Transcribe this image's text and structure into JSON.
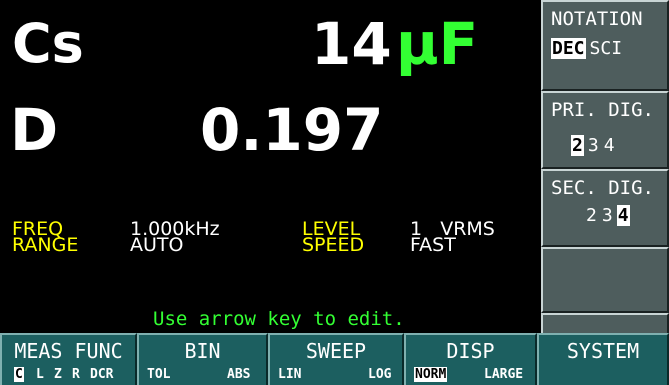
{
  "primary": {
    "label": "Cs",
    "value": "14",
    "unit": "µF"
  },
  "secondary": {
    "label": "D",
    "value": "0.197"
  },
  "params": {
    "freq_label": "FREQ",
    "freq_value": "1.000kHz",
    "range_label": "RANGE",
    "range_value": "AUTO",
    "level_label": "LEVEL",
    "level_value": "1   VRMS",
    "speed_label": "SPEED",
    "speed_value": "FAST"
  },
  "hint": "Use arrow key to edit.",
  "side_keys": {
    "notation": {
      "title": "NOTATION",
      "options": [
        "DEC",
        "SCI"
      ],
      "selected": "DEC"
    },
    "pri_dig": {
      "title": "PRI. DIG.",
      "options": [
        "2",
        "3",
        "4"
      ],
      "selected": "2"
    },
    "sec_dig": {
      "title": "SEC. DIG.",
      "options": [
        "2",
        "3",
        "4"
      ],
      "selected": "4"
    }
  },
  "function_keys": {
    "meas_func": {
      "label": "MEAS FUNC",
      "options": [
        "C",
        "L",
        "Z",
        "R",
        "DCR"
      ],
      "selected": "C"
    },
    "bin": {
      "label": "BIN",
      "options": [
        "TOL",
        "ABS"
      ]
    },
    "sweep": {
      "label": "SWEEP",
      "options": [
        "LIN",
        "LOG"
      ]
    },
    "disp": {
      "label": "DISP",
      "options": [
        "NORM",
        "LARGE"
      ],
      "selected": "NORM"
    },
    "system": {
      "label": "SYSTEM"
    }
  },
  "colors": {
    "background": "#000000",
    "unit_green": "#33ff33",
    "param_yellow": "#ffff00",
    "side_key_gray": "#4e5d5d",
    "function_key_teal": "#1c5f60"
  }
}
